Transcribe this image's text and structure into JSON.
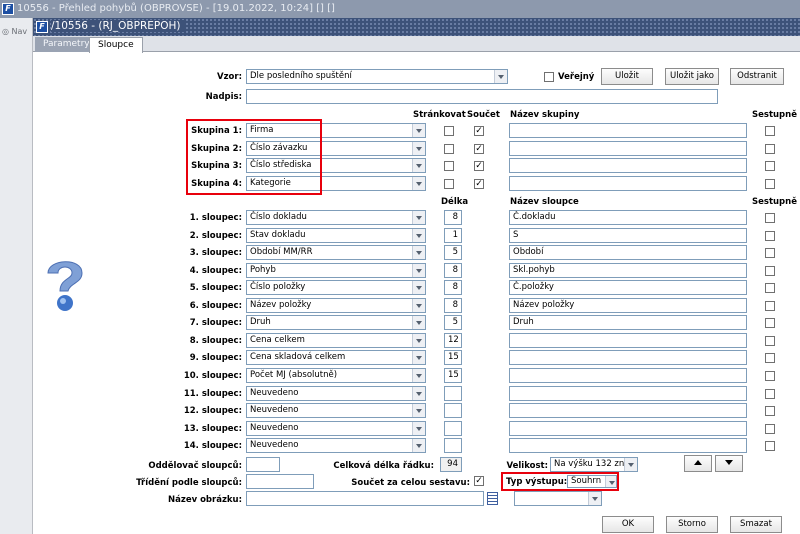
{
  "outer_window": {
    "title": "10556 - Přehled pohybů (OBPROVSE) - [19.01.2022, 10:24] [] []"
  },
  "nav": {
    "label": "Nav"
  },
  "inner_window": {
    "title": "/10556 - (RJ_OBPREPOH)"
  },
  "tabs": [
    {
      "label": "Parametry",
      "active": false
    },
    {
      "label": "Sloupce",
      "active": true
    }
  ],
  "form": {
    "vzor_label": "Vzor:",
    "vzor_value": "Dle posledního spuštění",
    "verejny_label": "Veřejný",
    "nadpis_label": "Nadpis:",
    "nadpis_value": ""
  },
  "toolbar": {
    "save": "Uložit",
    "save_as": "Uložit jako",
    "remove": "Odstranit"
  },
  "group_headers": {
    "strankovat": "Stránkovat",
    "soucet": "Součet",
    "nazev": "Název skupiny",
    "sestupne": "Sestupně"
  },
  "groups": [
    {
      "label": "Skupina 1:",
      "value": "Firma",
      "page": false,
      "sum": true,
      "name": "",
      "desc": false
    },
    {
      "label": "Skupina 2:",
      "value": "Číslo závazku",
      "page": false,
      "sum": true,
      "name": "",
      "desc": false
    },
    {
      "label": "Skupina 3:",
      "value": "Číslo střediska",
      "page": false,
      "sum": true,
      "name": "",
      "desc": false
    },
    {
      "label": "Skupina 4:",
      "value": "Kategorie",
      "page": false,
      "sum": true,
      "name": "",
      "desc": false
    }
  ],
  "column_headers": {
    "delka": "Délka",
    "nazev": "Název sloupce",
    "sestupne": "Sestupně"
  },
  "columns": [
    {
      "label": "1. sloupec:",
      "value": "Číslo dokladu",
      "len": "8",
      "name": "Č.dokladu"
    },
    {
      "label": "2. sloupec:",
      "value": "Stav dokladu",
      "len": "1",
      "name": "S"
    },
    {
      "label": "3. sloupec:",
      "value": "Období MM/RR",
      "len": "5",
      "name": "Období"
    },
    {
      "label": "4. sloupec:",
      "value": "Pohyb",
      "len": "8",
      "name": "Skl.pohyb"
    },
    {
      "label": "5. sloupec:",
      "value": "Číslo položky",
      "len": "8",
      "name": "Č.položky"
    },
    {
      "label": "6. sloupec:",
      "value": "Název položky",
      "len": "8",
      "name": "Název položky"
    },
    {
      "label": "7. sloupec:",
      "value": "Druh",
      "len": "5",
      "name": "Druh"
    },
    {
      "label": "8. sloupec:",
      "value": "Cena celkem",
      "len": "12",
      "name": ""
    },
    {
      "label": "9. sloupec:",
      "value": "Cena skladová celkem",
      "len": "15",
      "name": ""
    },
    {
      "label": "10. sloupec:",
      "value": "Počet MJ (absolutně)",
      "len": "15",
      "name": ""
    },
    {
      "label": "11. sloupec:",
      "value": "Neuvedeno",
      "len": "",
      "name": ""
    },
    {
      "label": "12. sloupec:",
      "value": "Neuvedeno",
      "len": "",
      "name": ""
    },
    {
      "label": "13. sloupec:",
      "value": "Neuvedeno",
      "len": "",
      "name": ""
    },
    {
      "label": "14. sloupec:",
      "value": "Neuvedeno",
      "len": "",
      "name": ""
    }
  ],
  "bottom": {
    "oddelovac_label": "Oddělovač sloupců:",
    "delka_label": "Celková délka řádku:",
    "delka_value": "94",
    "velikost_label": "Velikost:",
    "velikost_value": "Na výšku 132 zn.",
    "trideni_label": "Třídění podle sloupců:",
    "soucet_label": "Součet za celou sestavu:",
    "typ_label": "Typ výstupu:",
    "typ_value": "Souhrn",
    "obrazek_label": "Název obrázku:"
  },
  "buttons": {
    "ok": "OK",
    "storno": "Storno",
    "smazat": "Smazat"
  },
  "colors": {
    "highlight": "#e8000c",
    "titlebar": "#3d5279"
  }
}
